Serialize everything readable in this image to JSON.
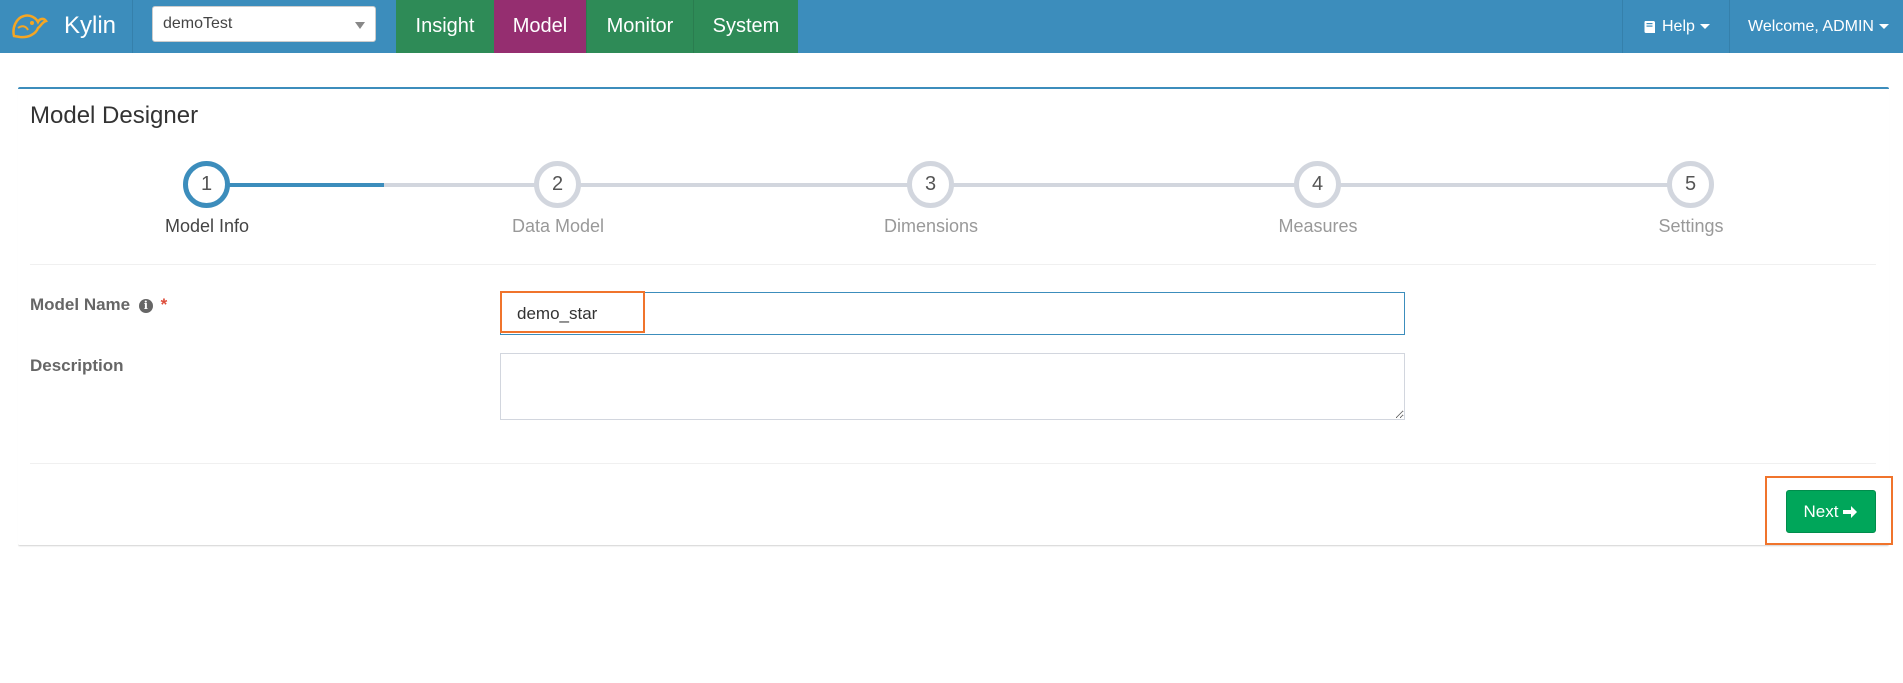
{
  "app": {
    "brand": "Kylin"
  },
  "project_select": {
    "value": "demoTest"
  },
  "nav": {
    "tabs": [
      {
        "label": "Insight"
      },
      {
        "label": "Model"
      },
      {
        "label": "Monitor"
      },
      {
        "label": "System"
      }
    ],
    "help": "Help",
    "user": "Welcome, ADMIN"
  },
  "page": {
    "title": "Model Designer"
  },
  "wizard": {
    "current_step": 1,
    "steps": [
      {
        "number": "1",
        "label": "Model Info"
      },
      {
        "number": "2",
        "label": "Data Model"
      },
      {
        "number": "3",
        "label": "Dimensions"
      },
      {
        "number": "4",
        "label": "Measures"
      },
      {
        "number": "5",
        "label": "Settings"
      }
    ]
  },
  "form": {
    "model_name": {
      "label": "Model Name",
      "required_mark": "*",
      "value": "demo_star"
    },
    "description": {
      "label": "Description",
      "value": ""
    }
  },
  "actions": {
    "next_label": "Next"
  },
  "colors": {
    "navbar": "#3c8dbc",
    "tab": "#2e8b57",
    "tab_active": "#952e70",
    "next_button": "#00a65a",
    "highlight": "#f0742c"
  },
  "icons": {
    "logo": "kylin-logo-icon",
    "help": "book-icon",
    "info": "info-icon",
    "next": "arrow-right-icon"
  }
}
